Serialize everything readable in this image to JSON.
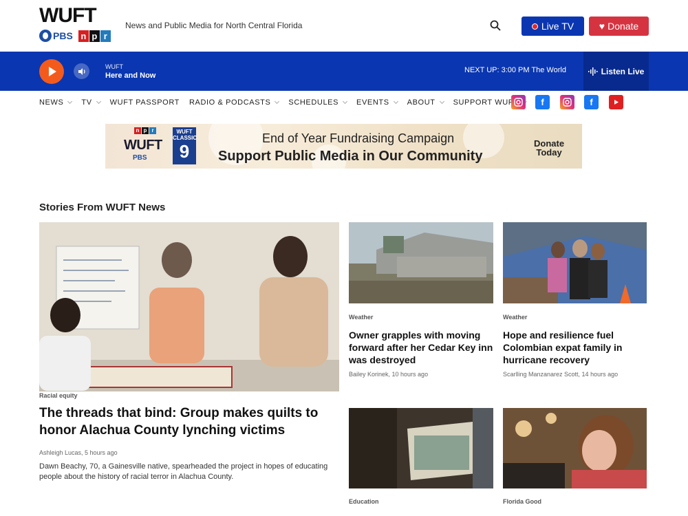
{
  "header": {
    "logo_text": "WUFT",
    "pbs_label": "PBS",
    "npr_letters": [
      "n",
      "p",
      "r"
    ],
    "tagline": "News and Public Media for North Central Florida",
    "live_tv_label": "Live TV",
    "donate_label": "Donate"
  },
  "player": {
    "station": "WUFT",
    "program": "Here and Now",
    "next_up_label": "NEXT UP:",
    "next_up_time": "3:00 PM",
    "next_up_show": "The World",
    "listen_live_label": "Listen Live"
  },
  "nav": {
    "items": [
      {
        "label": "NEWS",
        "dropdown": true
      },
      {
        "label": "TV",
        "dropdown": true
      },
      {
        "label": "WUFT PASSPORT",
        "dropdown": false
      },
      {
        "label": "RADIO & PODCASTS",
        "dropdown": true
      },
      {
        "label": "SCHEDULES",
        "dropdown": true
      },
      {
        "label": "EVENTS",
        "dropdown": true
      },
      {
        "label": "ABOUT",
        "dropdown": true
      },
      {
        "label": "SUPPORT WUFT",
        "dropdown": true
      }
    ],
    "social": [
      "instagram-icon",
      "facebook-icon",
      "instagram-icon",
      "facebook-icon",
      "youtube-icon"
    ]
  },
  "banner": {
    "logo_text": "WUFT",
    "pbs_label": "PBS",
    "classic_label": "WUFT CLASSIC",
    "classic_number": "9",
    "title": "End of Year Fundraising Campaign",
    "subtitle": "Support Public Media in Our Community",
    "donate_line1": "Donate",
    "donate_line2": "Today"
  },
  "section": {
    "title": "Stories From WUFT News"
  },
  "main_story": {
    "kicker": "Racial equity",
    "headline": "The threads that bind: Group makes quilts to honor Alachua County lynching victims",
    "byline": "Ashleigh Lucas, 5 hours ago",
    "teaser": "Dawn Beachy, 70, a Gainesville native, spearheaded the project in hopes of educating people about the history of racial terror in Alachua County."
  },
  "cards": [
    {
      "kicker": "Weather",
      "headline": "Owner grapples with moving forward after her Cedar Key inn was destroyed",
      "byline": "Bailey Korinek, 10 hours ago"
    },
    {
      "kicker": "Weather",
      "headline": "Hope and resilience fuel Colombian expat family in hurricane recovery",
      "byline": "Scarlling Manzanarez Scott, 14 hours ago"
    },
    {
      "kicker": "Education",
      "headline": "",
      "byline": ""
    },
    {
      "kicker": "Florida Good",
      "headline": "",
      "byline": ""
    }
  ],
  "colors": {
    "primary_blue": "#0a36b1",
    "donate_red": "#d63341",
    "play_orange": "#f35b1d"
  }
}
